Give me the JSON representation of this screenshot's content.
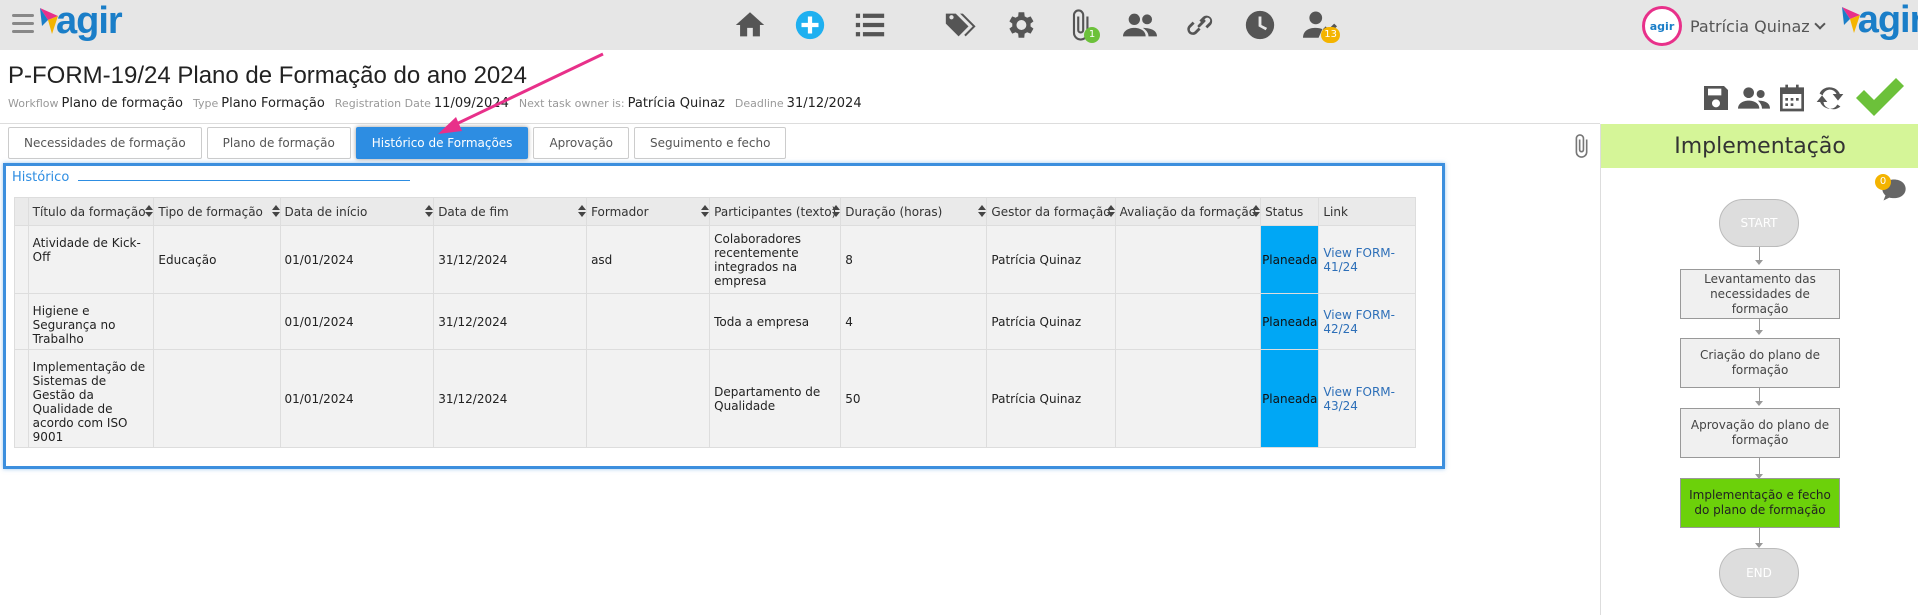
{
  "app": {
    "logo_text": "agir",
    "user_name": "Patrícia Quinaz",
    "avatar_text": "agir"
  },
  "nav": {
    "icons": [
      "home-icon",
      "add-icon",
      "list-icon",
      "tags-icon",
      "gear-icon",
      "paperclip-icon",
      "users-icon",
      "link-icon",
      "clock-icon",
      "user-check-icon"
    ],
    "attachments_badge": "1",
    "tasks_badge": "13"
  },
  "document": {
    "title": "P-FORM-19/24 Plano de Formação do ano 2024",
    "workflow_label": "Workflow",
    "workflow_value": "Plano de formação",
    "type_label": "Type",
    "type_value": "Plano Formação",
    "registration_label": "Registration Date",
    "registration_value": "11/09/2024",
    "owner_label": "Next task owner is:",
    "owner_value": "Patrícia Quinaz",
    "deadline_label": "Deadline",
    "deadline_value": "31/12/2024"
  },
  "tabs": [
    {
      "label": "Necessidades de formação"
    },
    {
      "label": "Plano de formação"
    },
    {
      "label": "Histórico de Formações"
    },
    {
      "label": "Aprovação"
    },
    {
      "label": "Seguimento e fecho"
    }
  ],
  "section": {
    "title": "Histórico"
  },
  "table": {
    "columns": [
      "Título da formação",
      "Tipo de formação",
      "Data de início",
      "Data de fim",
      "Formador",
      "Participantes (texto)",
      "Duração (horas)",
      "Gestor da formação",
      "Avaliação da formação",
      "Status",
      "Link"
    ],
    "rows": [
      {
        "titulo": "Atividade de Kick-Off",
        "tipo": "Educação",
        "inicio": "01/01/2024",
        "fim": "31/12/2024",
        "formador": "asd",
        "participantes": "Colaboradores recentemente integrados na empresa",
        "duracao": "8",
        "gestor": "Patrícia Quinaz",
        "avaliacao": "",
        "status": "Planeada",
        "link": "View FORM-41/24"
      },
      {
        "titulo": "Higiene e Segurança no Trabalho",
        "tipo": "",
        "inicio": "01/01/2024",
        "fim": "31/12/2024",
        "formador": "",
        "participantes": "Toda a empresa",
        "duracao": "4",
        "gestor": "Patrícia Quinaz",
        "avaliacao": "",
        "status": "Planeada",
        "link": "View FORM-42/24"
      },
      {
        "titulo": "Implementação de Sistemas de Gestão da Qualidade de acordo com ISO 9001",
        "tipo": "",
        "inicio": "01/01/2024",
        "fim": "31/12/2024",
        "formador": "",
        "participantes": "Departamento de Qualidade",
        "duracao": "50",
        "gestor": "Patrícia Quinaz",
        "avaliacao": "",
        "status": "Planeada",
        "link": "View FORM-43/24"
      }
    ]
  },
  "workflow_panel": {
    "header": "Implementação",
    "comments_badge": "0",
    "nodes": {
      "start": "START",
      "step1": "Levantamento das necessidades de formação",
      "step2": "Criação do plano de formação",
      "step3": "Aprovação do plano de formação",
      "step4": "Implementação e fecho do plano de formação",
      "end": "END"
    }
  },
  "colors": {
    "accent": "#2d8de2",
    "status_planeada": "#00a7f5",
    "current_step": "#6cd10a",
    "header_bg": "#d5f598",
    "annotation_arrow": "#e8308a"
  }
}
